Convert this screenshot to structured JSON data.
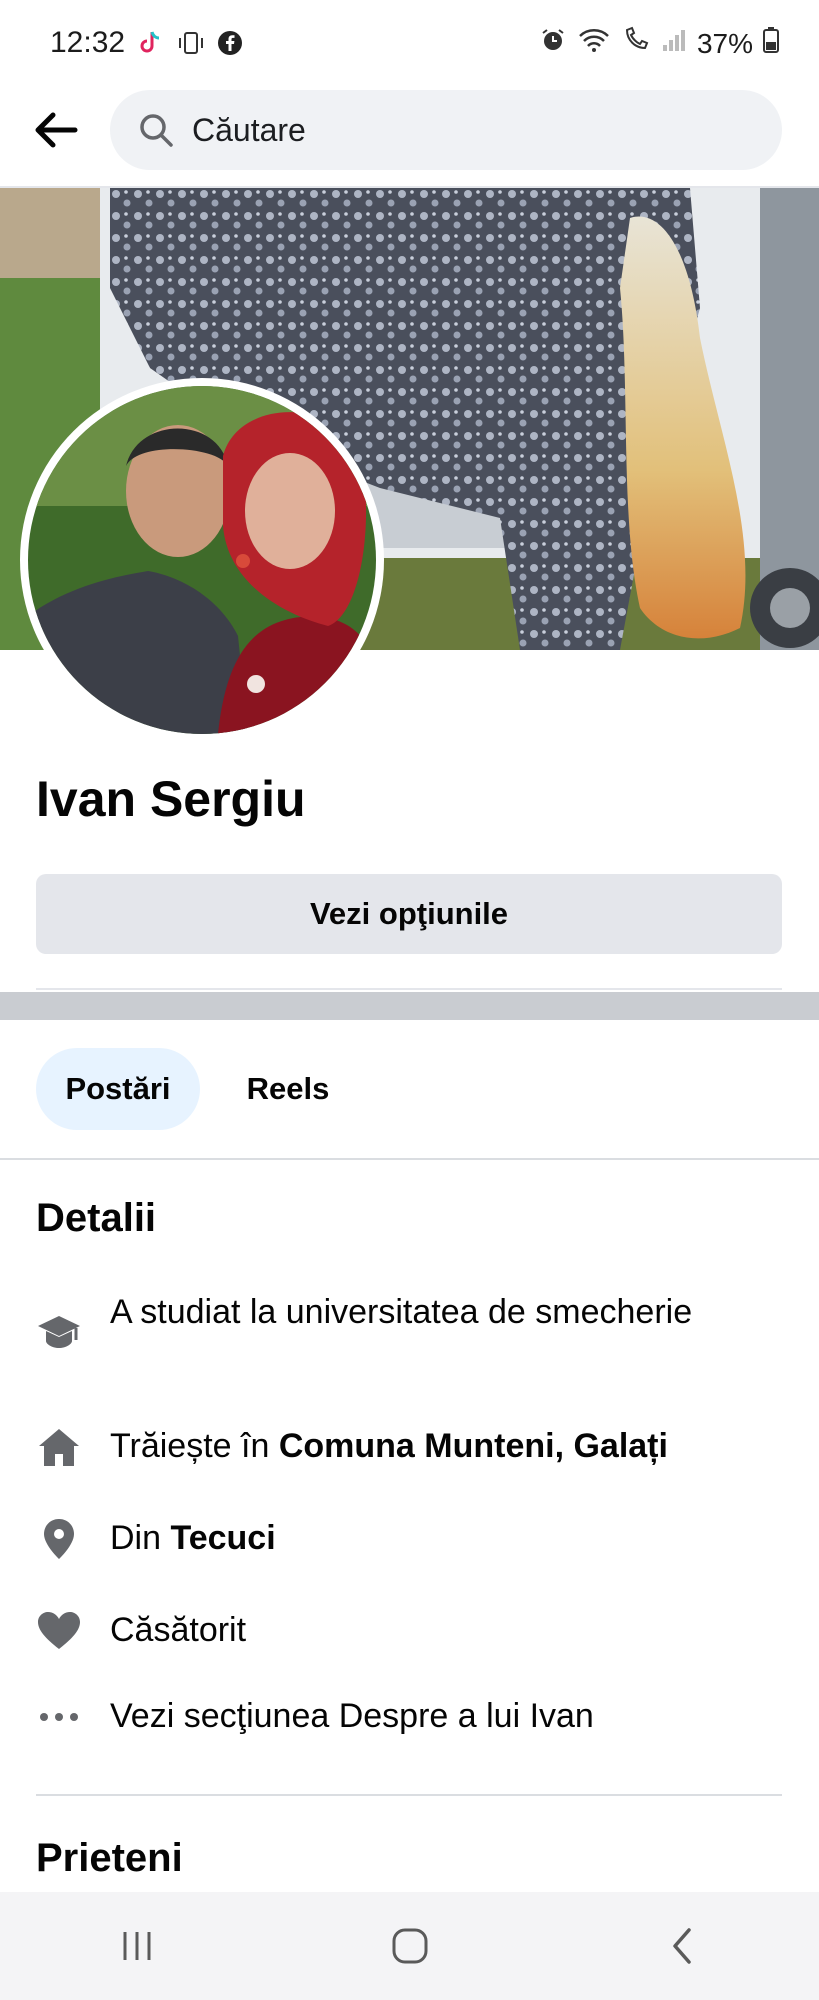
{
  "status_bar": {
    "time": "12:32",
    "left_icons": [
      "tiktok-icon",
      "vibrate-icon",
      "facebook-icon"
    ],
    "right_icons": [
      "alarm-icon",
      "wifi-icon",
      "wifi-call-icon",
      "signal-icon",
      "battery-icon"
    ],
    "battery": "37%"
  },
  "header": {
    "back_icon": "arrow-left-icon",
    "search_placeholder": "Căutare"
  },
  "profile": {
    "name": "Ivan Sergiu",
    "options_label": "Vezi opţiunile"
  },
  "tabs": [
    {
      "label": "Postări",
      "active": true
    },
    {
      "label": "Reels",
      "active": false
    }
  ],
  "details": {
    "title": "Detalii",
    "studied": "A studiat la universitatea de smecherie",
    "lives_prefix": "Trăiește în ",
    "lives_place": "Comuna Munteni, Galați",
    "from_prefix": "Din ",
    "from_place": "Tecuci",
    "relationship": "Căsătorit",
    "about_link": "Vezi secţiunea Despre a lui Ivan"
  },
  "friends": {
    "title": "Prieteni"
  },
  "colors": {
    "accent_tab_bg": "#e7f3ff",
    "button_bg": "#e4e6eb",
    "icon_gray": "#65676b"
  },
  "nav": [
    "recent-apps-icon",
    "home-icon",
    "back-icon"
  ]
}
